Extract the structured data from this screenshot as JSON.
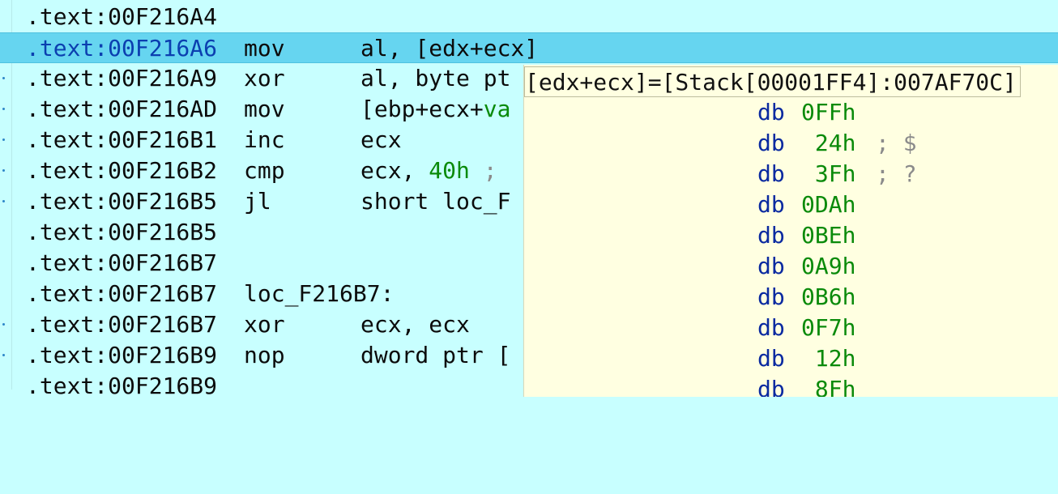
{
  "listing": {
    "rows": [
      {
        "addr": ".text:00F216A4",
        "mnemonic": "",
        "operands": "",
        "label": ""
      },
      {
        "addr": ".text:00F216A6",
        "mnemonic": "mov",
        "operands": "al, [edx+ecx]",
        "label": "",
        "selected": true
      },
      {
        "addr": ".text:00F216A9",
        "mnemonic": "xor",
        "operands": "al, byte pt",
        "label": ""
      },
      {
        "addr": ".text:00F216AD",
        "mnemonic": "mov",
        "operands": "[ebp+ecx+",
        "operands_tail": "va",
        "label": ""
      },
      {
        "addr": ".text:00F216B1",
        "mnemonic": "inc",
        "operands": "ecx",
        "label": ""
      },
      {
        "addr": ".text:00F216B2",
        "mnemonic": "cmp",
        "operands": "ecx, ",
        "operands_num": "40h",
        "operands_cmt": " ;",
        "label": ""
      },
      {
        "addr": ".text:00F216B5",
        "mnemonic": "jl",
        "operands": "short loc_F",
        "label": ""
      },
      {
        "addr": ".text:00F216B5",
        "mnemonic": "",
        "operands": "",
        "label": ""
      },
      {
        "addr": ".text:00F216B7",
        "mnemonic": "",
        "operands": "",
        "label": ""
      },
      {
        "addr": ".text:00F216B7",
        "mnemonic": "",
        "operands": "",
        "label": "loc_F216B7:"
      },
      {
        "addr": ".text:00F216B7",
        "mnemonic": "xor",
        "operands": "ecx, ecx",
        "label": ""
      },
      {
        "addr": ".text:00F216B9",
        "mnemonic": "nop",
        "operands": "dword ptr [",
        "label": ""
      },
      {
        "addr": ".text:00F216B9",
        "mnemonic": "",
        "operands": "",
        "label": ""
      }
    ]
  },
  "hint": {
    "title": "[edx+ecx]=[Stack[00001FF4]:007AF70C]",
    "rows": [
      {
        "directive": "db",
        "value": "0FFh",
        "comment": ""
      },
      {
        "directive": "db",
        "value": " 24h",
        "comment": "; $"
      },
      {
        "directive": "db",
        "value": " 3Fh",
        "comment": "; ?"
      },
      {
        "directive": "db",
        "value": "0DAh",
        "comment": ""
      },
      {
        "directive": "db",
        "value": "0BEh",
        "comment": ""
      },
      {
        "directive": "db",
        "value": "0A9h",
        "comment": ""
      },
      {
        "directive": "db",
        "value": "0B6h",
        "comment": ""
      },
      {
        "directive": "db",
        "value": "0F7h",
        "comment": ""
      },
      {
        "directive": "db",
        "value": " 12h",
        "comment": ""
      },
      {
        "directive": "db",
        "value": " 8Fh",
        "comment": ""
      }
    ]
  },
  "colors": {
    "background": "#c8ffff",
    "selection": "#66d5f0",
    "hint_background": "#ffffe1",
    "number": "#0a8a0a",
    "directive": "#0a2aa0",
    "comment": "#8b8b8b"
  }
}
